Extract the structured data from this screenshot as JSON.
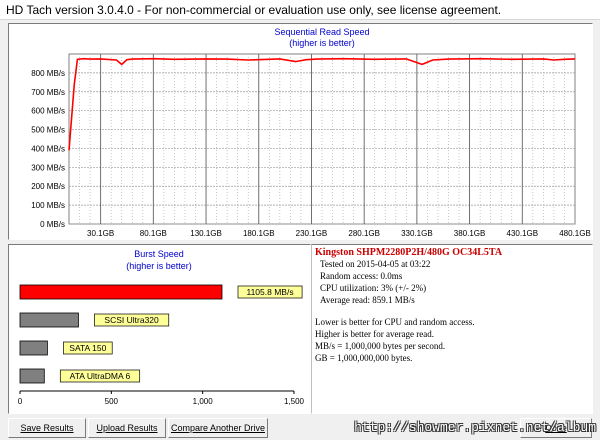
{
  "window": {
    "title": "HD Tach version 3.0.4.0  - For non-commercial or evaluation use only, see license agreement."
  },
  "chart_data": [
    {
      "type": "line",
      "title": "Sequential Read Speed",
      "subtitle": "(higher is better)",
      "y_tick_labels": [
        "0 MB/s",
        "100 MB/s",
        "200 MB/s",
        "300 MB/s",
        "400 MB/s",
        "500 MB/s",
        "600 MB/s",
        "700 MB/s",
        "800 MB/s"
      ],
      "x_tick_labels": [
        "30.1GB",
        "80.1GB",
        "130.1GB",
        "180.1GB",
        "230.1GB",
        "280.1GB",
        "330.1GB",
        "380.1GB",
        "430.1GB",
        "480.1GB"
      ],
      "ylim": [
        0,
        900
      ],
      "xlim": [
        0,
        480
      ],
      "grid": true,
      "series": [
        {
          "color": "#ff0000",
          "x": [
            0,
            5,
            8,
            14,
            20,
            30,
            45,
            50,
            55,
            60,
            80,
            100,
            130,
            150,
            170,
            200,
            215,
            225,
            235,
            260,
            290,
            320,
            335,
            345,
            360,
            390,
            420,
            450,
            460,
            470,
            480
          ],
          "y": [
            390,
            740,
            872,
            875,
            873,
            874,
            868,
            845,
            870,
            873,
            875,
            872,
            874,
            873,
            868,
            874,
            860,
            870,
            873,
            875,
            872,
            874,
            845,
            868,
            873,
            875,
            872,
            874,
            868,
            872,
            874
          ]
        }
      ]
    },
    {
      "type": "bar",
      "title": "Burst Speed",
      "subtitle": "(higher is better)",
      "x_tick_labels": [
        "0",
        "500",
        "1,000",
        "1,500"
      ],
      "xlim": [
        0,
        1500
      ],
      "categories": [
        "1105.8 MB/s",
        "SCSI Ultra320",
        "SATA 150",
        "ATA UltraDMA 6"
      ],
      "values": [
        1105.8,
        320,
        150,
        133
      ],
      "colors": [
        "#ff0000",
        "#808080",
        "#808080",
        "#808080"
      ]
    }
  ],
  "info": {
    "drive": "Kingston  SHPM2280P2H/480G OC34L5TA",
    "lines": [
      "Tested on 2015-04-05 at 03:22",
      "Random access: 0.0ms",
      "CPU utilization: 3% (+/- 2%)",
      "Average read: 859.1 MB/s"
    ],
    "notes": [
      "Lower is better for CPU and random access.",
      "Higher is better for average read.",
      "MB/s = 1,000,000 bytes per second.",
      "GB = 1,000,000,000 bytes."
    ]
  },
  "buttons": {
    "save": "Save Results",
    "upload": "Upload Results",
    "compare": "Compare Another Drive",
    "done": "Done"
  },
  "watermark": "http://showmer.pixnet.net/album"
}
